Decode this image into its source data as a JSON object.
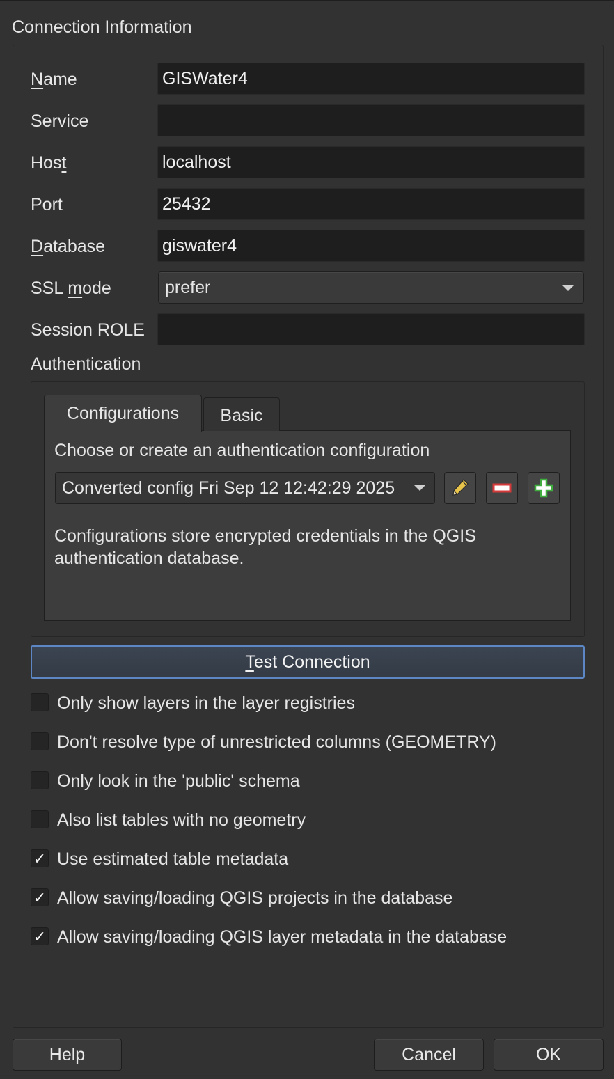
{
  "group": {
    "title": "Connection Information"
  },
  "fields": [
    {
      "label_pre": "",
      "label_ul": "N",
      "label_post": "ame",
      "value": "GISWater4"
    },
    {
      "label_pre": "Service",
      "label_ul": "",
      "label_post": "",
      "value": ""
    },
    {
      "label_pre": "Hos",
      "label_ul": "t",
      "label_post": "",
      "value": "localhost"
    },
    {
      "label_pre": "Port",
      "label_ul": "",
      "label_post": "",
      "value": "25432"
    },
    {
      "label_pre": "",
      "label_ul": "D",
      "label_post": "atabase",
      "value": "giswater4"
    },
    {
      "label_pre": "SSL ",
      "label_ul": "m",
      "label_post": "ode",
      "value": "prefer"
    },
    {
      "label_pre": "Session ROLE",
      "label_ul": "",
      "label_post": "",
      "value": ""
    }
  ],
  "auth": {
    "label": "Authentication",
    "tabs": [
      "Configurations",
      "Basic"
    ],
    "heading": "Choose or create an authentication configuration",
    "selected_config": "Converted config Fri Sep 12 12:42:29 2025",
    "description": "Configurations store encrypted credentials in the QGIS authentication database.",
    "buttons": {
      "edit": "pencil-icon",
      "remove": "minus-icon",
      "add": "plus-icon"
    }
  },
  "test_button": {
    "pre": "",
    "ul": "T",
    "post": "est Connection"
  },
  "options": [
    {
      "label": "Only show layers in the layer registries",
      "checked": false
    },
    {
      "label": "Don't resolve type of unrestricted columns (GEOMETRY)",
      "checked": false
    },
    {
      "label": "Only look in the 'public' schema",
      "checked": false
    },
    {
      "label": "Also list tables with no geometry",
      "checked": false
    },
    {
      "label": "Use estimated table metadata",
      "checked": true
    },
    {
      "label": "Allow saving/loading QGIS projects in the database",
      "checked": true
    },
    {
      "label": "Allow saving/loading QGIS layer metadata in the database",
      "checked": true
    }
  ],
  "check_mark": "✓",
  "footer": {
    "help": "Help",
    "cancel": "Cancel",
    "ok": "OK"
  },
  "colors": {
    "focus_border": "#5d86c4",
    "remove_red": "#d43a3a",
    "add_green": "#3fae3f",
    "pencil_yellow": "#e8c44a"
  }
}
